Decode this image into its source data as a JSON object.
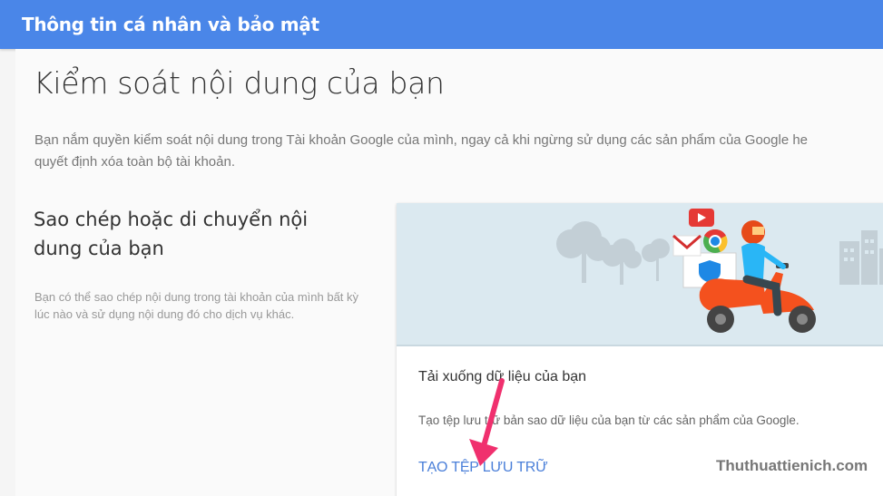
{
  "header": {
    "title": "Thông tin cá nhân và bảo mật"
  },
  "page": {
    "title": "Kiểm soát nội dung của bạn",
    "intro_line1": "Bạn nắm quyền kiểm soát nội dung trong Tài khoản Google của mình, ngay cả khi ngừng sử dụng các sản phẩm của Google he",
    "intro_line2": "quyết định xóa toàn bộ tài khoản."
  },
  "section": {
    "title": "Sao chép hoặc di chuyển nội dung của bạn",
    "description": "Bạn có thể sao chép nội dung trong tài khoản của mình bất kỳ lúc nào và sử dụng nội dung đó cho dịch vụ khác."
  },
  "card": {
    "title": "Tải xuống dữ liệu của bạn",
    "description": "Tạo tệp lưu trữ bản sao dữ liệu của bạn từ các sản phẩm của Google.",
    "action_label": "TẠO TỆP LƯU TRỮ"
  },
  "illustration": {
    "background_color": "#dbe9f0",
    "scooter_color": "#f4511e",
    "icons": [
      "youtube-icon",
      "gmail-icon",
      "chrome-icon",
      "shield-icon"
    ]
  },
  "annotation": {
    "arrow_color": "#f0306e"
  },
  "watermark": {
    "text": "Thuthuattienich.com"
  },
  "colors": {
    "header": "#4a86e8",
    "link": "#4a7fd9"
  }
}
